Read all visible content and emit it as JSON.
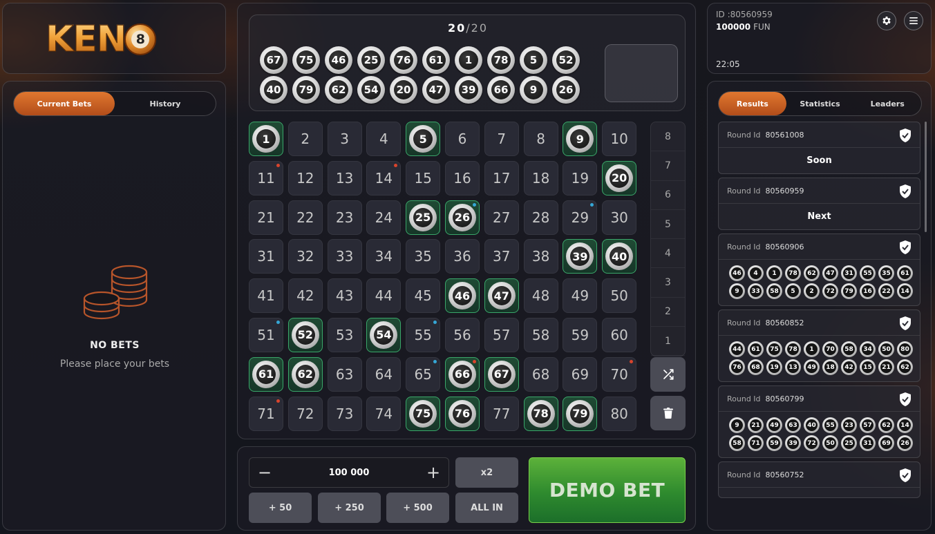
{
  "logo": {
    "text": "KEN",
    "ball_number": "8"
  },
  "left_panel": {
    "tabs": [
      {
        "label": "Current Bets",
        "active": true
      },
      {
        "label": "History",
        "active": false
      }
    ],
    "empty_title": "NO BETS",
    "empty_subtitle": "Please place your bets"
  },
  "draw": {
    "count_current": "20",
    "count_total": "20",
    "balls_row1": [
      "67",
      "75",
      "46",
      "25",
      "76",
      "61",
      "1",
      "78",
      "5",
      "52"
    ],
    "balls_row2": [
      "40",
      "79",
      "62",
      "54",
      "20",
      "47",
      "39",
      "66",
      "9",
      "26"
    ]
  },
  "board": {
    "numbers": [
      "1",
      "2",
      "3",
      "4",
      "5",
      "6",
      "7",
      "8",
      "9",
      "10",
      "11",
      "12",
      "13",
      "14",
      "15",
      "16",
      "17",
      "18",
      "19",
      "20",
      "21",
      "22",
      "23",
      "24",
      "25",
      "26",
      "27",
      "28",
      "29",
      "30",
      "31",
      "32",
      "33",
      "34",
      "35",
      "36",
      "37",
      "38",
      "39",
      "40",
      "41",
      "42",
      "43",
      "44",
      "45",
      "46",
      "47",
      "48",
      "49",
      "50",
      "51",
      "52",
      "53",
      "54",
      "55",
      "56",
      "57",
      "58",
      "59",
      "60",
      "61",
      "62",
      "63",
      "64",
      "65",
      "66",
      "67",
      "68",
      "69",
      "70",
      "71",
      "72",
      "73",
      "74",
      "75",
      "76",
      "77",
      "78",
      "79",
      "80"
    ],
    "hits": [
      "1",
      "5",
      "9",
      "20",
      "25",
      "26",
      "39",
      "40",
      "46",
      "47",
      "52",
      "54",
      "61",
      "62",
      "66",
      "67",
      "75",
      "76",
      "78",
      "79"
    ],
    "red_dots": [
      "11",
      "14",
      "66",
      "70",
      "71"
    ],
    "blue_dots": [
      "26",
      "29",
      "51",
      "55",
      "65"
    ],
    "paytable": [
      "8",
      "7",
      "6",
      "5",
      "4",
      "3",
      "2",
      "1"
    ],
    "shuffle_icon": "shuffle-icon",
    "clear_icon": "trash-icon"
  },
  "bet": {
    "minus": "−",
    "amount": "100 000",
    "plus": "+",
    "x2": "x2",
    "quick": [
      "+ 50",
      "+ 250",
      "+ 500"
    ],
    "all_in": "ALL IN",
    "demo_bet": "DEMO BET"
  },
  "user": {
    "id": "ID :80560959",
    "balance": "100000",
    "currency": "FUN",
    "time": "22:05",
    "settings_icon": "gear-icon",
    "menu_icon": "menu-icon"
  },
  "results": {
    "tabs": [
      {
        "label": "Results",
        "active": true
      },
      {
        "label": "Statistics",
        "active": false
      },
      {
        "label": "Leaders",
        "active": false
      }
    ],
    "round_label": "Round Id",
    "rounds": [
      {
        "id": "80561008",
        "status": "Soon"
      },
      {
        "id": "80560959",
        "status": "Next"
      },
      {
        "id": "80560906",
        "balls": [
          [
            "46",
            "4",
            "1",
            "78",
            "62",
            "47",
            "31",
            "55",
            "35",
            "61"
          ],
          [
            "9",
            "33",
            "58",
            "5",
            "2",
            "72",
            "79",
            "16",
            "22",
            "14"
          ]
        ]
      },
      {
        "id": "80560852",
        "balls": [
          [
            "44",
            "61",
            "75",
            "78",
            "1",
            "70",
            "58",
            "34",
            "50",
            "80"
          ],
          [
            "76",
            "68",
            "19",
            "13",
            "49",
            "18",
            "42",
            "15",
            "21",
            "62"
          ]
        ]
      },
      {
        "id": "80560799",
        "balls": [
          [
            "9",
            "21",
            "49",
            "63",
            "40",
            "55",
            "23",
            "57",
            "62",
            "14"
          ],
          [
            "58",
            "71",
            "59",
            "39",
            "72",
            "50",
            "25",
            "31",
            "69",
            "26"
          ]
        ]
      },
      {
        "id": "80560752",
        "balls": []
      }
    ]
  },
  "colors": {
    "accent": "#d8692a",
    "hit": "#3aa76a",
    "bet": "#3f9a34"
  }
}
